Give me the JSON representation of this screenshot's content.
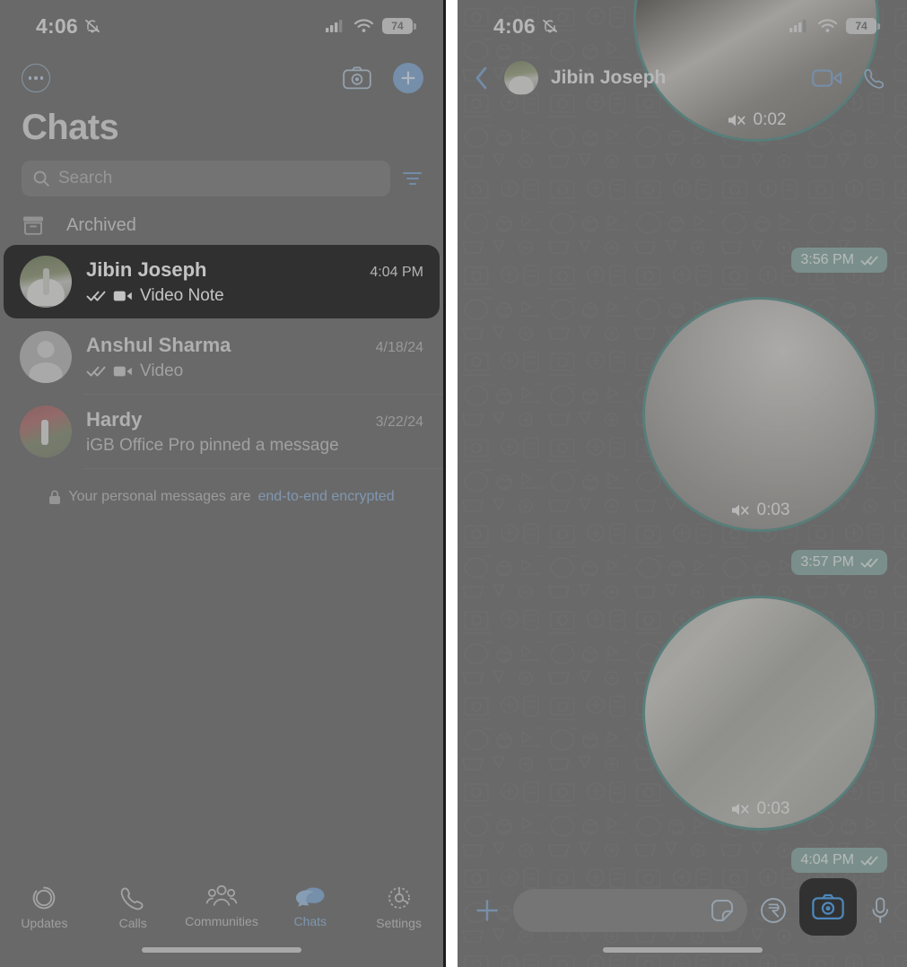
{
  "status_bar": {
    "time": "4:06",
    "bell_icon": "bell-slash-icon",
    "signal_icon": "cellular-signal-icon",
    "wifi_icon": "wifi-icon",
    "battery_level": "74"
  },
  "left_panel": {
    "nav": {
      "menu_icon": "more-options-icon",
      "camera_icon": "camera-icon",
      "new_chat_icon": "plus-icon"
    },
    "title": "Chats",
    "search": {
      "placeholder": "Search",
      "search_icon": "search-icon",
      "filter_icon": "filter-icon"
    },
    "archived": {
      "label": "Archived",
      "icon": "archive-box-icon"
    },
    "chats": [
      {
        "name": "Jibin Joseph",
        "time": "4:04 PM",
        "preview": "Video Note",
        "status_icon": "double-check-icon",
        "media_icon": "video-camera-icon",
        "selected": true,
        "avatar": "photo-man-with-car"
      },
      {
        "name": "Anshul Sharma",
        "time": "4/18/24",
        "preview": "Video",
        "status_icon": "double-check-icon",
        "media_icon": "video-camera-icon",
        "selected": false,
        "avatar": "default-person-placeholder"
      },
      {
        "name": "Hardy",
        "time": "3/22/24",
        "preview": "iGB Office Pro pinned a message",
        "status_icon": "",
        "media_icon": "",
        "selected": false,
        "avatar": "photo-person-red"
      }
    ],
    "encryption_notice": {
      "lock_icon": "lock-icon",
      "text": "Your personal messages are",
      "link": "end-to-end encrypted"
    },
    "tabs": [
      {
        "label": "Updates",
        "icon": "updates-status-icon",
        "selected": false
      },
      {
        "label": "Calls",
        "icon": "phone-icon",
        "selected": false
      },
      {
        "label": "Communities",
        "icon": "communities-people-icon",
        "selected": false
      },
      {
        "label": "Chats",
        "icon": "chat-bubbles-icon",
        "selected": true
      },
      {
        "label": "Settings",
        "icon": "gear-icon",
        "selected": false
      }
    ]
  },
  "right_panel": {
    "header": {
      "back_icon": "chevron-left-icon",
      "contact_name": "Jibin Joseph",
      "avatar": "photo-man-with-car",
      "video_call_icon": "video-call-icon",
      "voice_call_icon": "phone-call-icon"
    },
    "messages": [
      {
        "type": "video-note",
        "duration": "0:02",
        "muted_icon": "speaker-muted-icon",
        "time": "3:56 PM",
        "status_icon": "double-check-icon"
      },
      {
        "type": "video-note",
        "duration": "0:03",
        "muted_icon": "speaker-muted-icon",
        "time": "3:57 PM",
        "status_icon": "double-check-icon"
      },
      {
        "type": "video-note",
        "duration": "0:03",
        "muted_icon": "speaker-muted-icon",
        "time": "4:04 PM",
        "status_icon": "double-check-icon"
      }
    ],
    "composer": {
      "attach_icon": "plus-icon",
      "input_value": "",
      "sticker_icon": "sticker-icon",
      "payment_icon": "rupee-payment-icon",
      "camera_icon": "camera-icon",
      "mic_icon": "microphone-icon",
      "camera_highlighted": true
    }
  },
  "theme": {
    "accent_blue": "#7da7d4",
    "bubble_teal": "#85a9a2",
    "ring_teal": "#4e8d86",
    "panel_bg": "#696969",
    "selected_row_bg": "#0b0b0b"
  }
}
